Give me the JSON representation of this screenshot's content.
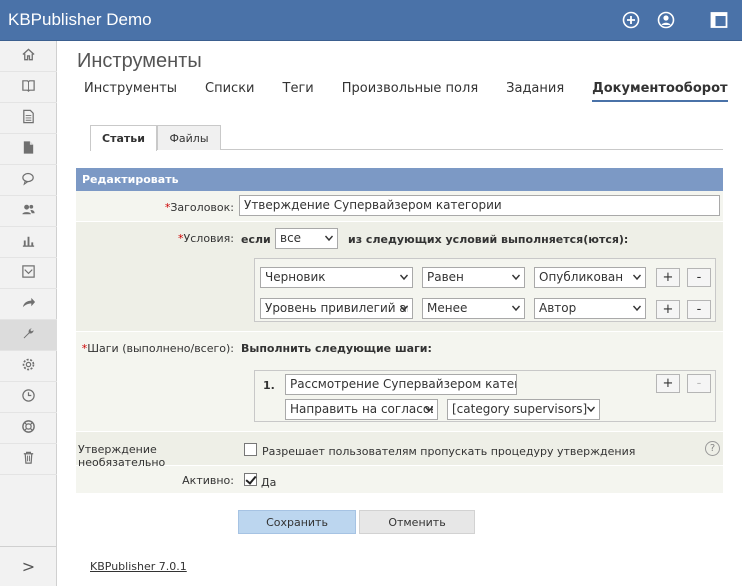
{
  "app": {
    "title": "KBPublisher Demo"
  },
  "top_icons": [
    "plus-circle-icon",
    "user-icon",
    "window-icon"
  ],
  "sidebar": {
    "items": [
      {
        "icon": "home-icon"
      },
      {
        "icon": "book-icon"
      },
      {
        "icon": "document-icon"
      },
      {
        "icon": "file-icon"
      },
      {
        "icon": "comments-icon"
      },
      {
        "icon": "users-icon"
      },
      {
        "icon": "chart-icon"
      },
      {
        "icon": "image-icon"
      },
      {
        "icon": "share-icon"
      },
      {
        "icon": "wrench-icon",
        "active": true
      },
      {
        "icon": "gear-icon"
      },
      {
        "icon": "clock-icon"
      },
      {
        "icon": "lifebuoy-icon"
      },
      {
        "icon": "trash-icon"
      }
    ],
    "expand": ">"
  },
  "page": {
    "title": "Инструменты"
  },
  "nav": {
    "tabs": [
      "Инструменты",
      "Списки",
      "Теги",
      "Произвольные поля",
      "Задания",
      "Документооборот"
    ],
    "active": 5
  },
  "subtabs": {
    "tabs": [
      "Статьи",
      "Файлы"
    ],
    "active": 0
  },
  "form": {
    "section_title": "Редактировать",
    "title_label": "Заголовок:",
    "title_value": "Утверждение Супервайзером категории",
    "conditions_label": "Условия:",
    "if_label": "если",
    "match_select": "все",
    "match_suffix": "из следующих условий выполняется(ются):",
    "conditions": [
      {
        "field": "Черновик",
        "op": "Равен",
        "value": "Опубликован"
      },
      {
        "field": "Уровень привилегий ав",
        "op": "Менее",
        "value": "Автор"
      }
    ],
    "steps_label": "Шаги (выполнено/всего):",
    "steps_heading": "Выполнить следующие шаги:",
    "steps": [
      {
        "num": "1.",
        "title": "Рассмотрение Супервайзером категори",
        "action": "Направить на согласов",
        "target": "[category supervisors]"
      }
    ],
    "plus": "+",
    "minus": "-",
    "optional_label": "Утверждение необязательно",
    "optional_text": "Разрешает пользователям пропускать процедуру утверждения",
    "help": "?",
    "active_label": "Активно:",
    "active_text": "Да",
    "save": "Сохранить",
    "cancel": "Отменить"
  },
  "footer": {
    "version": "KBPublisher 7.0.1"
  }
}
